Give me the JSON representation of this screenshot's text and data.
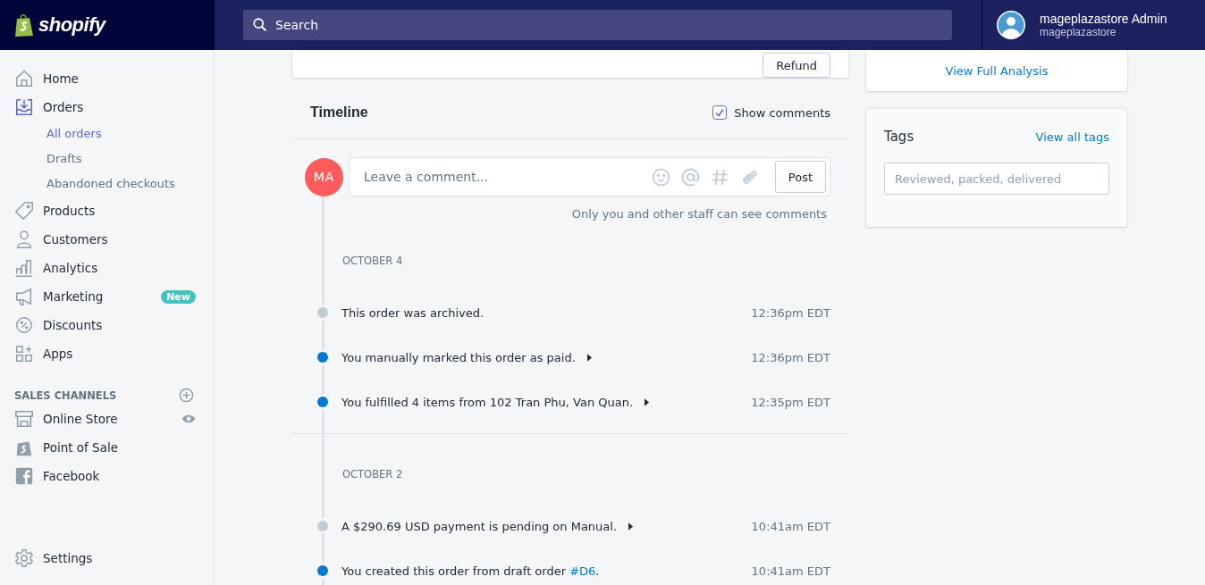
{
  "brand": "shopify",
  "search": {
    "placeholder": "Search"
  },
  "user": {
    "name": "mageplazastore Admin",
    "store": "mageplazastore"
  },
  "nav": [
    {
      "label": "Home",
      "selected": false
    },
    {
      "label": "Orders",
      "selected": true,
      "children": [
        {
          "label": "All orders",
          "selected": true
        },
        {
          "label": "Drafts",
          "selected": false
        },
        {
          "label": "Abandoned checkouts",
          "selected": false
        }
      ]
    },
    {
      "label": "Products",
      "selected": false
    },
    {
      "label": "Customers",
      "selected": false
    },
    {
      "label": "Analytics",
      "selected": false
    },
    {
      "label": "Marketing",
      "selected": false,
      "badge": "New"
    },
    {
      "label": "Discounts",
      "selected": false
    },
    {
      "label": "Apps",
      "selected": false
    }
  ],
  "sales_channels": {
    "title": "SALES CHANNELS",
    "items": [
      {
        "label": "Online Store",
        "selected": false,
        "viewable": true
      },
      {
        "label": "Point of Sale",
        "selected": false,
        "viewable": false
      },
      {
        "label": "Facebook",
        "selected": false,
        "viewable": false
      }
    ]
  },
  "settings": {
    "label": "Settings",
    "selected": false
  },
  "refund_button": "Refund",
  "timeline": {
    "title": "Timeline",
    "show_comments": {
      "label": "Show comments",
      "checked": true
    },
    "avatar": "MA",
    "comment": {
      "placeholder": "Leave a comment..."
    },
    "post_button": "Post",
    "note": "Only you and other staff can see comments",
    "groups": [
      {
        "date": "OCTOBER 4",
        "events": [
          {
            "text": "This order was archived.",
            "time": "12:36pm EDT",
            "color": "#c4cdd5",
            "expandable": false
          },
          {
            "text": "You manually marked this order as paid.",
            "time": "12:36pm EDT",
            "color": "#0078d4",
            "expandable": true
          },
          {
            "text": "You fulfilled 4 items from 102 Tran Phu, Van Quan.",
            "time": "12:35pm EDT",
            "color": "#0078d4",
            "expandable": true
          }
        ]
      },
      {
        "date": "OCTOBER 2",
        "events": [
          {
            "text": "A $290.69 USD payment is pending on Manual.",
            "time": "10:41am EDT",
            "color": "#c4cdd5",
            "expandable": true
          },
          {
            "text": "You created this order from draft order ",
            "link": "#D6",
            "text_after": ".",
            "time": "10:41am EDT",
            "color": "#0078d4",
            "expandable": false
          }
        ]
      }
    ]
  },
  "analysis_link": "View Full Analysis",
  "tags": {
    "title": "Tags",
    "link": "View all tags",
    "placeholder": "Reviewed, packed, delivered"
  }
}
